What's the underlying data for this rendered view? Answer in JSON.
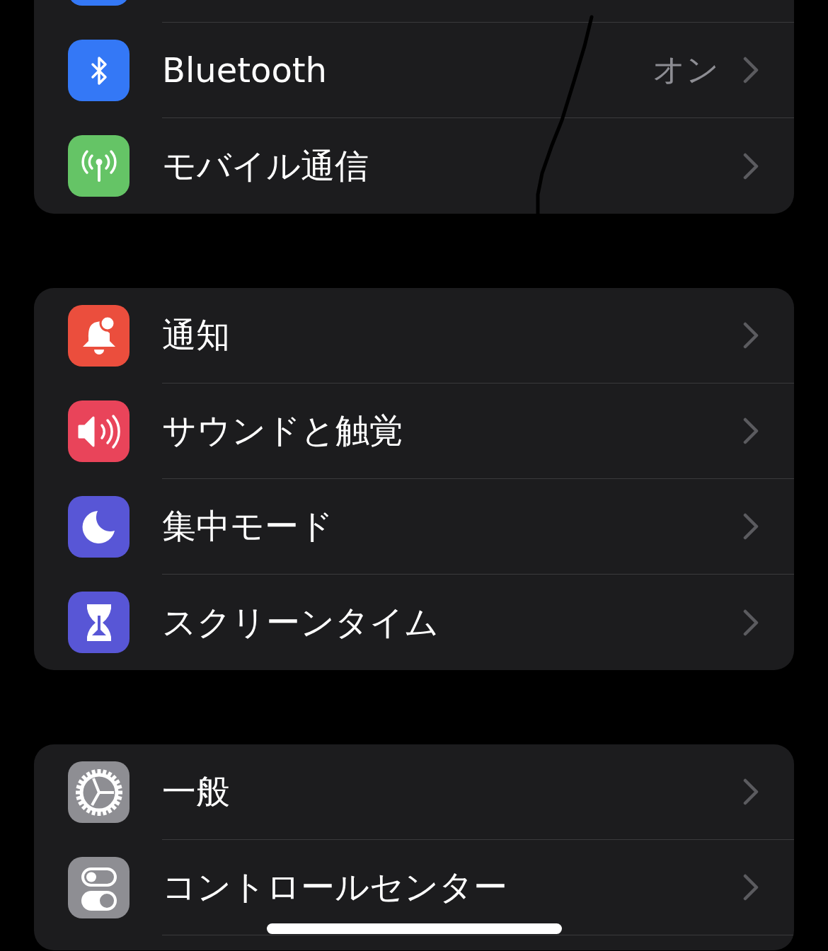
{
  "groups": [
    {
      "items": [
        {
          "kind": "blank",
          "color": "#3478f6"
        },
        {
          "kind": "bluetooth",
          "color": "#3478f6",
          "label": "Bluetooth",
          "value": "オン"
        },
        {
          "kind": "antenna",
          "color": "#65c466",
          "label": "モバイル通信"
        }
      ]
    },
    {
      "items": [
        {
          "kind": "bell",
          "color": "#eb4e3d",
          "label": "通知"
        },
        {
          "kind": "speaker",
          "color": "#e9445a",
          "label": "サウンドと触覚"
        },
        {
          "kind": "moon",
          "color": "#5856d6",
          "label": "集中モード"
        },
        {
          "kind": "hourglass",
          "color": "#5856d6",
          "label": "スクリーンタイム"
        }
      ]
    },
    {
      "items": [
        {
          "kind": "gear",
          "color": "#8e8e93",
          "label": "一般"
        },
        {
          "kind": "switches",
          "color": "#8e8e93",
          "label": "コントロールセンター"
        },
        {
          "kind": "empty"
        }
      ]
    }
  ]
}
